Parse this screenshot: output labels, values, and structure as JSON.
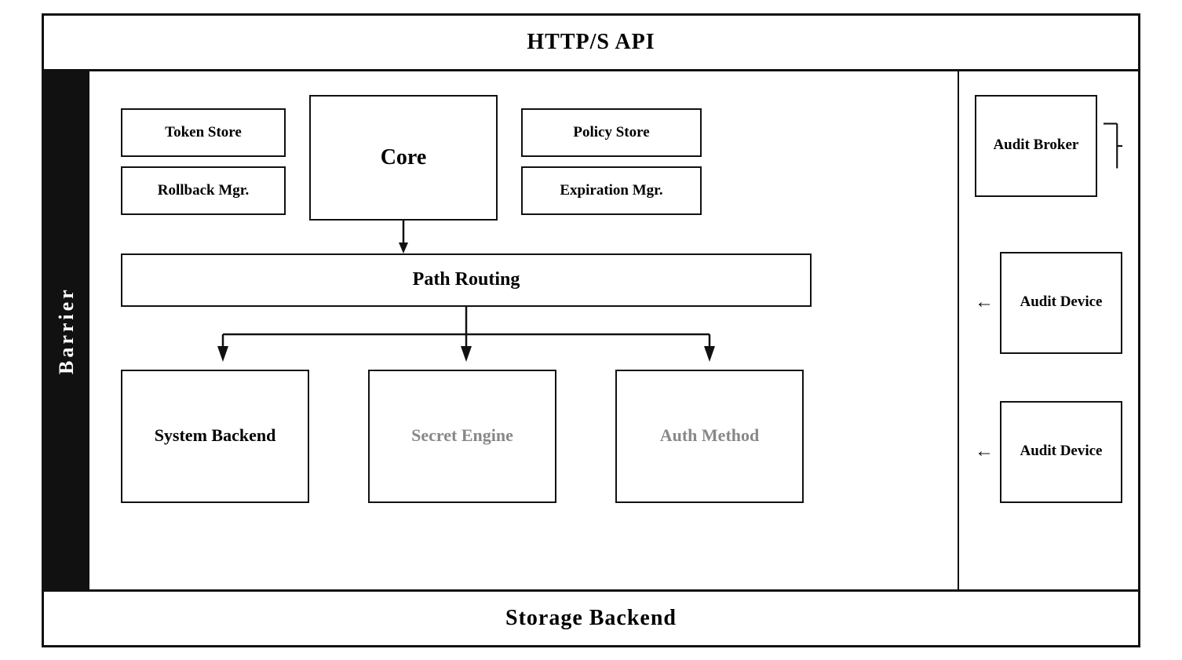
{
  "header": {
    "label": "HTTP/S API"
  },
  "footer": {
    "label": "Storage Backend"
  },
  "barrier": {
    "label": "Barrier"
  },
  "diagram": {
    "token_store": "Token Store",
    "rollback_mgr": "Rollback Mgr.",
    "core": "Core",
    "policy_store": "Policy Store",
    "expiration_mgr": "Expiration Mgr.",
    "audit_broker": "Audit Broker",
    "path_routing": "Path Routing",
    "system_backend": "System Backend",
    "secret_engine": "Secret Engine",
    "auth_method": "Auth Method",
    "audit_device_1": "Audit Device",
    "audit_device_2": "Audit Device"
  }
}
